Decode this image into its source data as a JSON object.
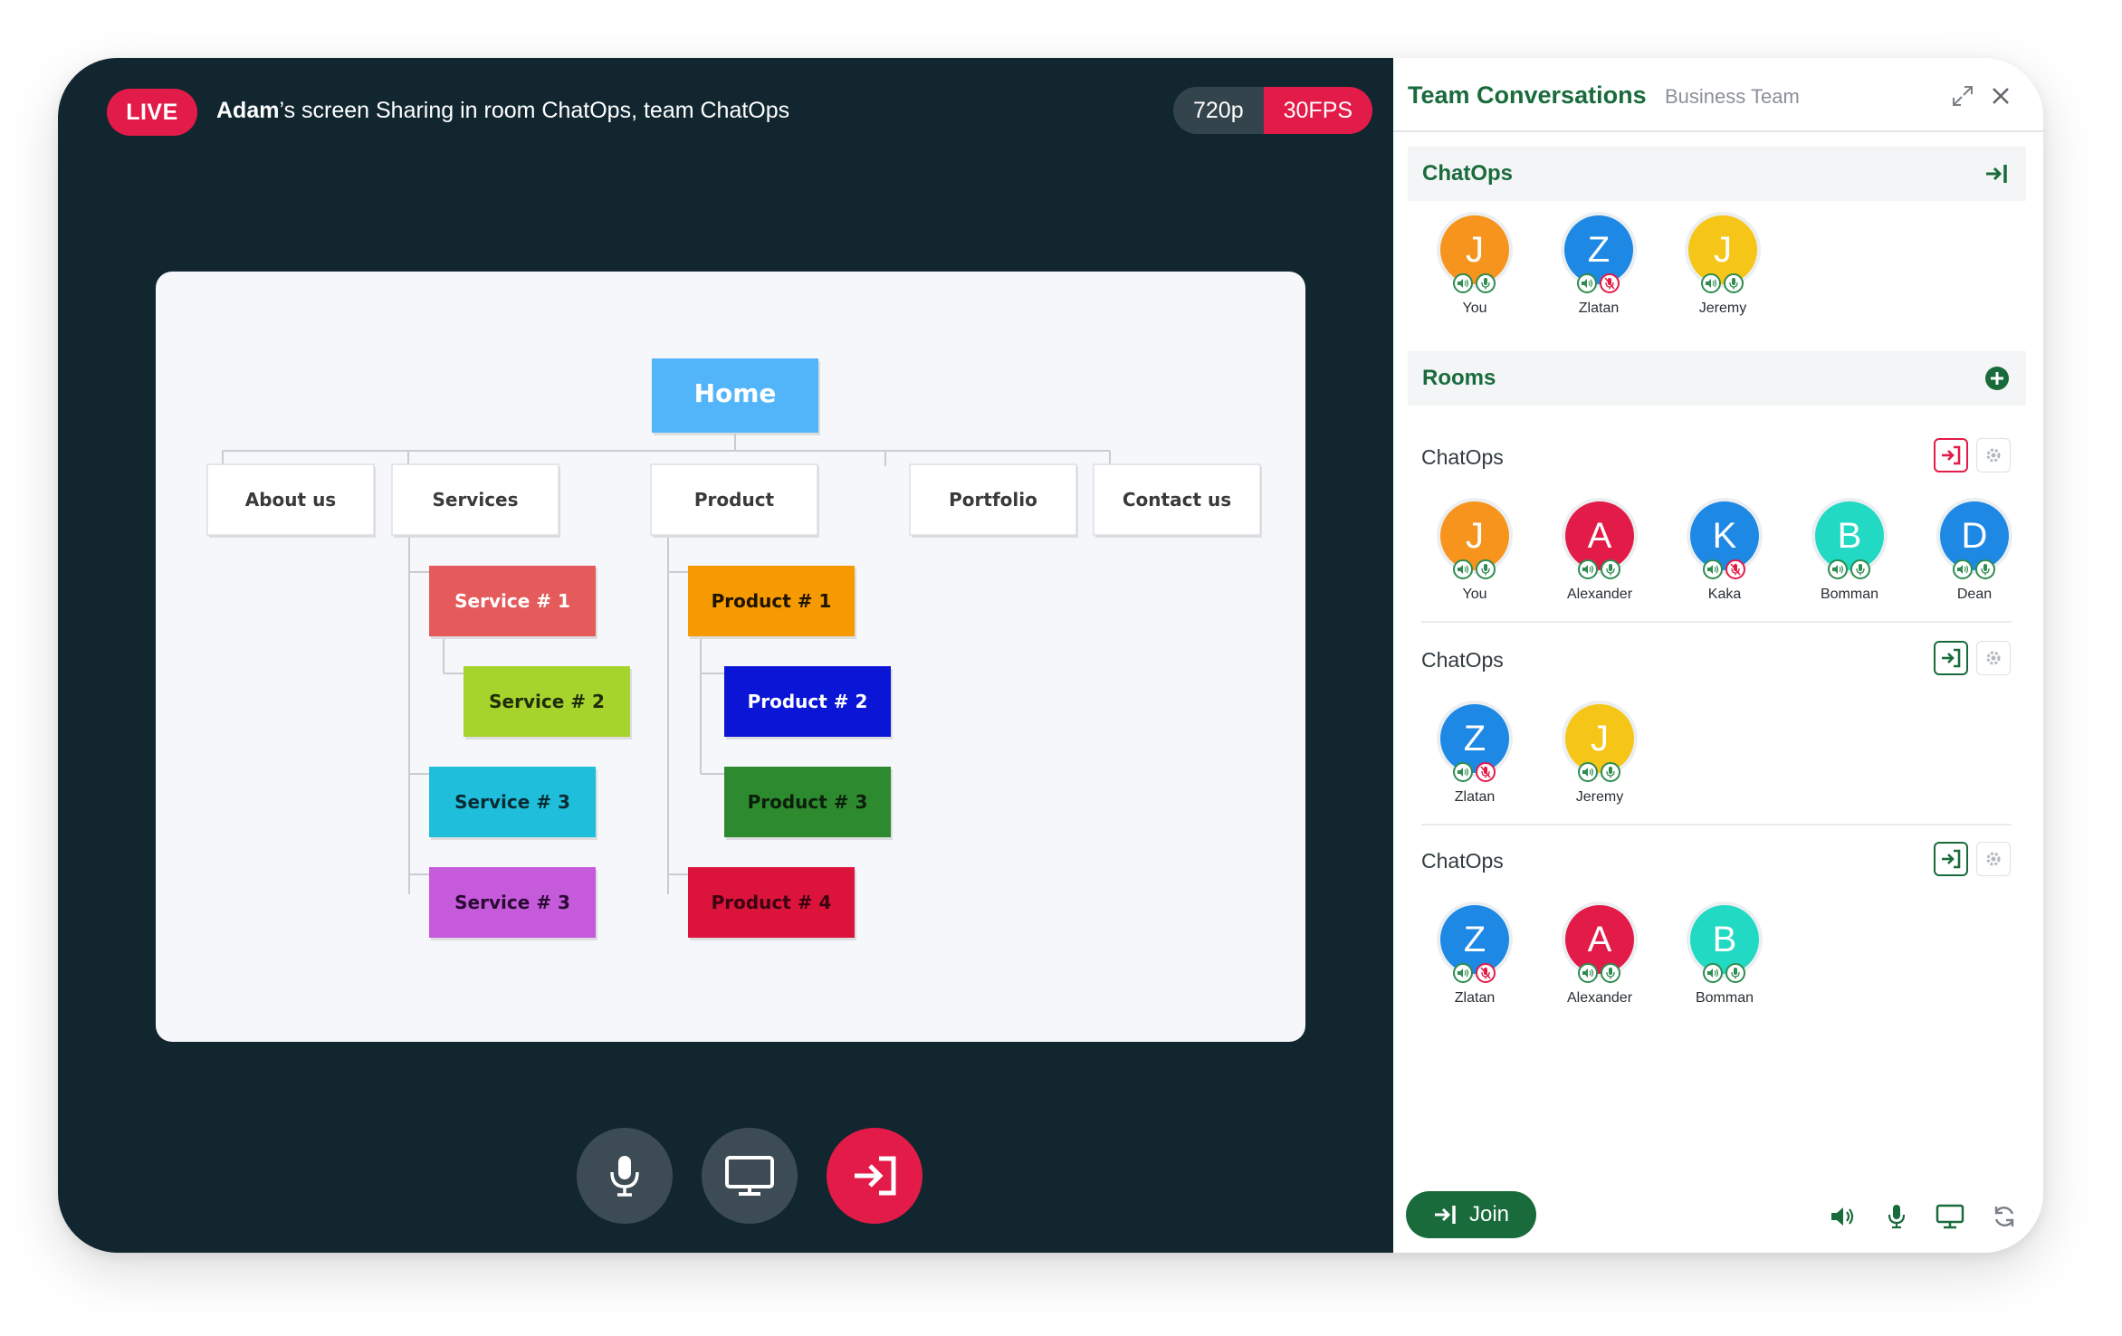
{
  "stage": {
    "live_label": "LIVE",
    "sharer": "Adam",
    "share_text": "’s screen Sharing in room ChatOps, team ChatOps",
    "resolution": "720p",
    "fps": "30FPS"
  },
  "sitemap": {
    "home": "Home",
    "nav": [
      "About us",
      "Services",
      "Product",
      "Portfolio",
      "Contact us"
    ],
    "services": [
      "Service # 1",
      "Service # 2",
      "Service # 3",
      "Service # 3"
    ],
    "products": [
      "Product # 1",
      "Product # 2",
      "Product # 3",
      "Product # 4"
    ]
  },
  "panel": {
    "title": "Team Conversations",
    "subtitle": "Business Team",
    "chatops_label": "ChatOps",
    "rooms_label": "Rooms",
    "join_label": "Join"
  },
  "team_members": [
    {
      "initial": "J",
      "name": "You",
      "color": "#f7941d",
      "mic_muted": false
    },
    {
      "initial": "Z",
      "name": "Zlatan",
      "color": "#1e88e5",
      "mic_muted": true
    },
    {
      "initial": "J",
      "name": "Jeremy",
      "color": "#f5c518",
      "mic_muted": false
    }
  ],
  "rooms": [
    {
      "name": "ChatOps",
      "joined": true,
      "members": [
        {
          "initial": "J",
          "name": "You",
          "color": "#f7941d",
          "mic_muted": false
        },
        {
          "initial": "A",
          "name": "Alexander",
          "color": "#e31b48",
          "mic_muted": false
        },
        {
          "initial": "K",
          "name": "Kaka",
          "color": "#1e88e5",
          "mic_muted": true
        },
        {
          "initial": "B",
          "name": "Bomman",
          "color": "#22d9c4",
          "mic_muted": false
        },
        {
          "initial": "D",
          "name": "Dean",
          "color": "#1e88e5",
          "mic_muted": false
        }
      ]
    },
    {
      "name": "ChatOps",
      "joined": false,
      "members": [
        {
          "initial": "Z",
          "name": "Zlatan",
          "color": "#1e88e5",
          "mic_muted": true
        },
        {
          "initial": "J",
          "name": "Jeremy",
          "color": "#f5c518",
          "mic_muted": false
        }
      ]
    },
    {
      "name": "ChatOps",
      "joined": false,
      "members": [
        {
          "initial": "Z",
          "name": "Zlatan",
          "color": "#1e88e5",
          "mic_muted": true
        },
        {
          "initial": "A",
          "name": "Alexander",
          "color": "#e31b48",
          "mic_muted": false
        },
        {
          "initial": "B",
          "name": "Bomman",
          "color": "#22d9c4",
          "mic_muted": false
        }
      ]
    }
  ],
  "colors": {
    "brand_green": "#1a6b3c",
    "live_red": "#e31b48",
    "stage_bg": "#122630"
  }
}
